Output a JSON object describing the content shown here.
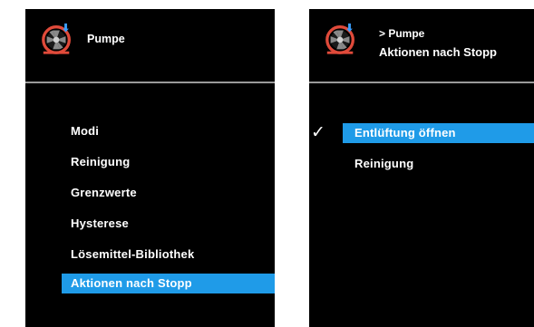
{
  "colors": {
    "screen_bg": "#000000",
    "text": "#ffffff",
    "highlight": "#1f9be8",
    "divider": "#9a9a9a",
    "icon_ring": "#e04a3a",
    "icon_blade": "#8a8a8a"
  },
  "left_panel": {
    "header": {
      "icon": "pump-icon",
      "title": "Pumpe"
    },
    "menu": [
      {
        "label": "Modi",
        "selected": false
      },
      {
        "label": "Reinigung",
        "selected": false
      },
      {
        "label": "Grenzwerte",
        "selected": false
      },
      {
        "label": "Hysterese",
        "selected": false
      },
      {
        "label": "Lösemittel-Bibliothek",
        "selected": false
      },
      {
        "label": "Aktionen nach Stopp",
        "selected": true
      }
    ]
  },
  "right_panel": {
    "header": {
      "icon": "pump-icon",
      "breadcrumb": "> Pumpe",
      "title": "Aktionen nach Stopp"
    },
    "menu": [
      {
        "label": "Entlüftung öffnen",
        "selected": true,
        "checked": true,
        "check_mark": "✓"
      },
      {
        "label": "Reinigung",
        "selected": false,
        "checked": false
      }
    ]
  }
}
